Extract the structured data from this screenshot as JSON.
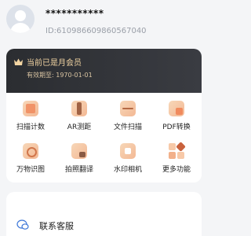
{
  "profile": {
    "username": "***********",
    "user_id": "ID:6109866098605670​40"
  },
  "vip": {
    "title": "当前已是月会员",
    "expire": "有效期至: 1970-01-01",
    "colors": {
      "gold": "#f3d5a3",
      "card": "#2b2d31"
    }
  },
  "features": [
    {
      "label": "扫描计数",
      "icon": "scan-count-icon"
    },
    {
      "label": "AR测距",
      "icon": "ar-ruler-icon"
    },
    {
      "label": "文件扫描",
      "icon": "file-scan-icon"
    },
    {
      "label": "PDF转换",
      "icon": "pdf-convert-icon"
    },
    {
      "label": "万物识图",
      "icon": "image-recognition-icon"
    },
    {
      "label": "拍照翻译",
      "icon": "photo-translate-icon"
    },
    {
      "label": "水印相机",
      "icon": "watermark-camera-icon"
    },
    {
      "label": "更多功能",
      "icon": "more-features-icon"
    }
  ],
  "service": {
    "label": "联系客服",
    "icon": "customer-service-icon"
  }
}
